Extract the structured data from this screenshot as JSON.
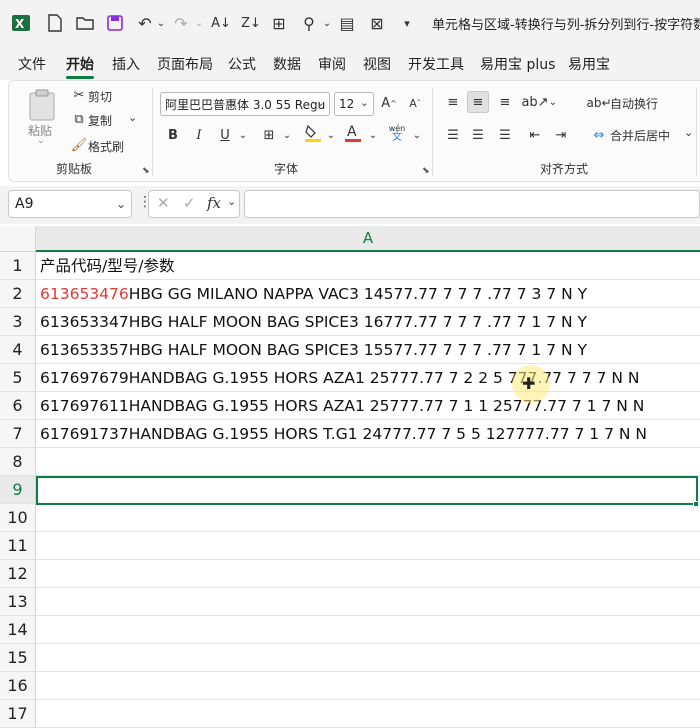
{
  "window": {
    "title": "单元格与区域-转换行与列-拆分列到行-按字符数.xl"
  },
  "menu_tabs": [
    {
      "label": "文件"
    },
    {
      "label": "开始"
    },
    {
      "label": "插入"
    },
    {
      "label": "页面布局"
    },
    {
      "label": "公式"
    },
    {
      "label": "数据"
    },
    {
      "label": "审阅"
    },
    {
      "label": "视图"
    },
    {
      "label": "开发工具"
    },
    {
      "label": "易用宝 plus"
    },
    {
      "label": "易用宝"
    }
  ],
  "ribbon": {
    "clipboard": {
      "paste": "粘贴",
      "cut": "剪切",
      "copy": "复制",
      "format_painter": "格式刷",
      "group": "剪贴板"
    },
    "font": {
      "font_name": "阿里巴巴普惠体 3.0 55 Regu",
      "font_size": "12",
      "group": "字体"
    },
    "alignment": {
      "wrap_text": "自动换行",
      "merge_center": "合并后居中",
      "group": "对齐方式"
    }
  },
  "formula_bar": {
    "name_box": "A9",
    "formula": ""
  },
  "sheet": {
    "column_header": "A",
    "rows": [
      {
        "num": "1",
        "prefix": "",
        "text": "产品代码/型号/参数"
      },
      {
        "num": "2",
        "prefix": "613653476",
        "text": "HBG GG MILANO NAPPA VAC3 14577.77 7 7 7 .77 7 3 7 N Y"
      },
      {
        "num": "3",
        "prefix": "",
        "text": "613653347HBG HALF MOON BAG SPICE3 16777.77 7 7 7 .77 7 1 7 N Y"
      },
      {
        "num": "4",
        "prefix": "",
        "text": "613653357HBG HALF MOON BAG SPICE3 15577.77 7 7 7 .77 7 1 7 N Y"
      },
      {
        "num": "5",
        "prefix": "",
        "text": "617697679HANDBAG G.1955 HORS AZA1 25777.77 7 2 2 5 777.77 7 7 7 N N"
      },
      {
        "num": "6",
        "prefix": "",
        "text": "617697611HANDBAG G.1955 HORS AZA1 25777.77 7 1 1 25777.77 7 1 7 N N"
      },
      {
        "num": "7",
        "prefix": "",
        "text": "617691737HANDBAG G.1955 HORS T.G1 24777.77 7 5 5 127777.77 7 1 7 N N"
      },
      {
        "num": "8",
        "prefix": "",
        "text": ""
      },
      {
        "num": "9",
        "prefix": "",
        "text": ""
      },
      {
        "num": "10",
        "prefix": "",
        "text": ""
      },
      {
        "num": "11",
        "prefix": "",
        "text": ""
      },
      {
        "num": "12",
        "prefix": "",
        "text": ""
      },
      {
        "num": "13",
        "prefix": "",
        "text": ""
      },
      {
        "num": "14",
        "prefix": "",
        "text": ""
      },
      {
        "num": "15",
        "prefix": "",
        "text": ""
      },
      {
        "num": "16",
        "prefix": "",
        "text": ""
      },
      {
        "num": "17",
        "prefix": "",
        "text": ""
      }
    ]
  },
  "colors": {
    "accent": "#107c41",
    "red_text": "#e53935",
    "excel_logo": "#1d6f42"
  }
}
